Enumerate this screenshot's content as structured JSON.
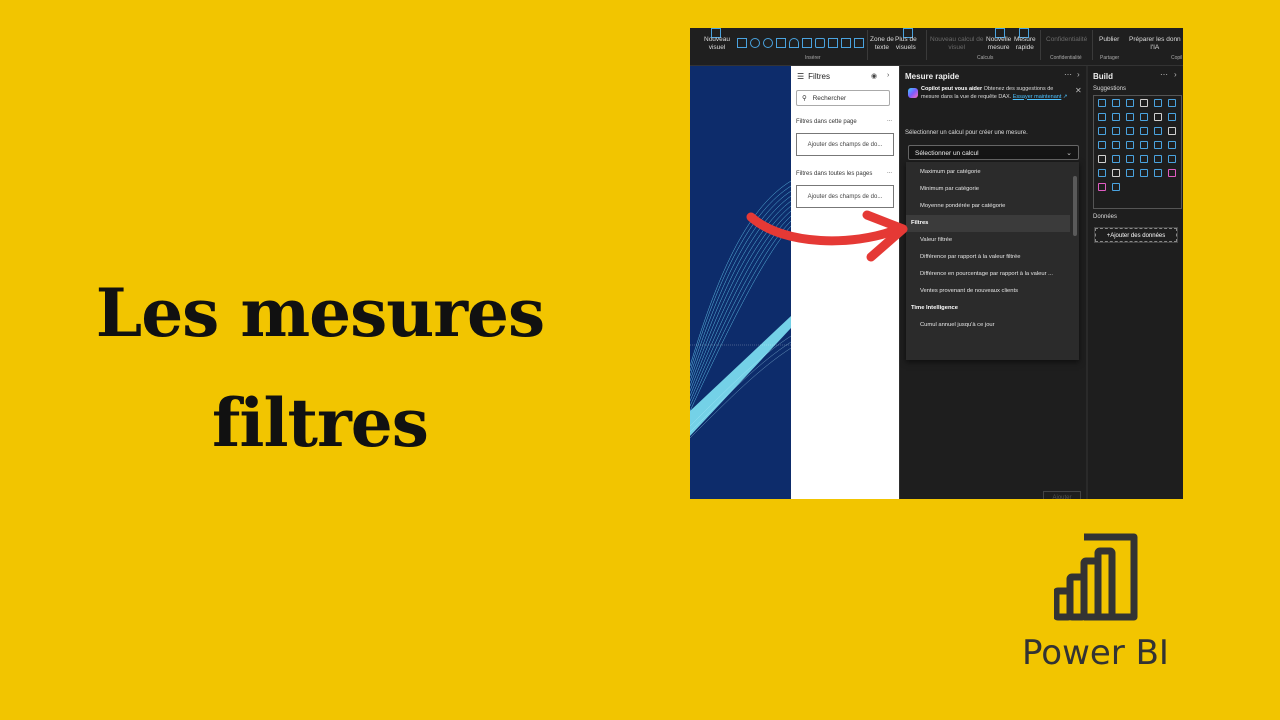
{
  "slide": {
    "title_line1": "Les mesures",
    "title_line2": "filtres",
    "brand": "Power BI",
    "colors": {
      "background": "#F2C500",
      "arrow": "#E53935",
      "title": "#111111"
    }
  },
  "ribbon": {
    "buttons": [
      {
        "id": "nouveau-visuel",
        "label": "Nouveau\nvisuel",
        "enabled": true
      },
      {
        "id": "zone-de-texte",
        "label": "Zone de\ntexte",
        "enabled": true
      },
      {
        "id": "plus-de-visuels",
        "label": "Plus de\nvisuels",
        "enabled": true
      },
      {
        "id": "nouveau-calcul-de-visuel",
        "label": "Nouveau calcul de\nvisuel",
        "enabled": false
      },
      {
        "id": "nouvelle-mesure",
        "label": "Nouvelle\nmesure",
        "enabled": true
      },
      {
        "id": "mesure-rapide",
        "label": "Mesure\nrapide",
        "enabled": true
      },
      {
        "id": "confidentialite",
        "label": "Confidentialité",
        "enabled": false
      },
      {
        "id": "publier",
        "label": "Publier",
        "enabled": true
      },
      {
        "id": "preparer-ia",
        "label": "Préparer les donn\nl'IA",
        "enabled": true
      }
    ],
    "groups": [
      "Insérer",
      "Calculs",
      "Confidentialité",
      "Partager",
      "Copil"
    ]
  },
  "filters_pane": {
    "title": "Filtres",
    "search_placeholder": "Rechercher",
    "section_page": "Filtres dans cette page",
    "section_all": "Filtres dans toutes les pages",
    "add_fields": "Ajouter des champs de do...",
    "dots": "..."
  },
  "quick_measure": {
    "title": "Mesure rapide",
    "copilot_bold": "Copilot peut vous aider",
    "copilot_text": " Obtenez des suggestions de mesure dans la vue de requête DAX.",
    "copilot_link": "Essayer maintenant",
    "prompt": "Sélectionner un calcul pour créer une mesure.",
    "select_value": "Sélectionner un calcul",
    "options": [
      {
        "type": "item",
        "label": "Maximum par catégorie"
      },
      {
        "type": "item",
        "label": "Minimum par catégorie"
      },
      {
        "type": "item",
        "label": "Moyenne pondérée par catégorie"
      },
      {
        "type": "group",
        "label": "Filtres"
      },
      {
        "type": "item",
        "label": "Valeur filtrée"
      },
      {
        "type": "item",
        "label": "Différence par rapport à la valeur filtrée"
      },
      {
        "type": "item",
        "label": "Différence en pourcentage par rapport à la valeur ..."
      },
      {
        "type": "item",
        "label": "Ventes provenant de nouveaux clients"
      },
      {
        "type": "group",
        "label": "Time Intelligence"
      },
      {
        "type": "item",
        "label": "Cumul annuel jusqu'à ce jour"
      }
    ],
    "add_button": "Ajouter"
  },
  "build_pane": {
    "title": "Build",
    "suggestions": "Suggestions",
    "data_label": "Données",
    "add_data": "+Ajouter des données"
  }
}
